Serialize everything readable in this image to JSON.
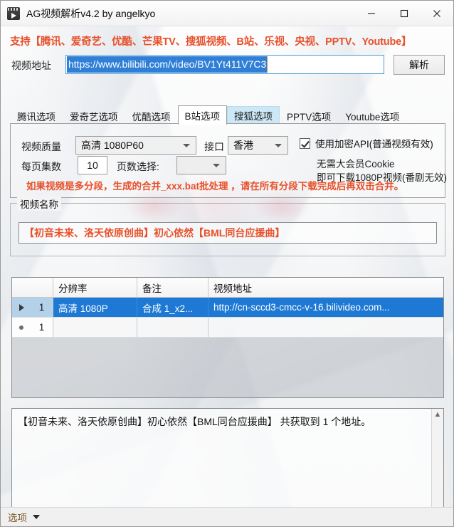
{
  "window": {
    "title": "AG视频解析v4.2 by angelkyo",
    "icon": "film-play-icon",
    "minimize_label": "minimize",
    "maximize_label": "maximize",
    "close_label": "close"
  },
  "header": {
    "support_text": "支持【腾讯、爱奇艺、优酷、芒果TV、搜狐视频、B站、乐视、央视、PPTV、Youtube】",
    "support_color": "#e8502a"
  },
  "url_row": {
    "label": "视频地址",
    "value": "https://www.bilibili.com/video/BV1Yt411V7C3",
    "placeholder": "",
    "selected": true,
    "parse_button": "解析"
  },
  "tabs": [
    {
      "label": "腾讯选项",
      "state": "normal"
    },
    {
      "label": "爱奇艺选项",
      "state": "normal"
    },
    {
      "label": "优酷选项",
      "state": "normal"
    },
    {
      "label": "B站选项",
      "state": "active"
    },
    {
      "label": "搜狐选项",
      "state": "hover"
    },
    {
      "label": "PPTV选项",
      "state": "normal"
    },
    {
      "label": "Youtube选项",
      "state": "normal"
    }
  ],
  "panel": {
    "quality_label": "视频质量",
    "quality_value": "高清 1080P60",
    "api_label": "接口",
    "api_value": "香港",
    "encrypt_checkbox_label": "使用加密API(普通视频有效)",
    "encrypt_checked": true,
    "note_line1": "无需大会员Cookie",
    "note_line2": "即可下载1080P视频(番剧无效)",
    "episodes_label": "每页集数",
    "episodes_value": "10",
    "page_select_label": "页数选择:",
    "page_select_value": "",
    "warning": "如果视频是多分段，生成的合并_xxx.bat批处理 ，请在所有分段下载完成后再双击合并。",
    "warning_color": "#e8502a"
  },
  "name_group": {
    "title": "视频名称",
    "value": "【初音未来、洛天依原创曲】初心依然【BML同台应援曲】",
    "value_color": "#e8502a"
  },
  "grid": {
    "columns": [
      "",
      "分辨率",
      "备注",
      "视频地址"
    ],
    "rows": [
      {
        "marker": "arrow",
        "number": "1",
        "resolution": "高清 1080P",
        "note": "合成 1_x2...",
        "url": "http://cn-sccd3-cmcc-v-16.bilivideo.com...",
        "selected": true
      },
      {
        "marker": "new",
        "number": "1",
        "resolution": "",
        "note": "",
        "url": "",
        "selected": false
      }
    ],
    "selection_color": "#1e79d4"
  },
  "log": {
    "text": "【初音未来、洛天依原创曲】初心依然【BML同台应援曲】 共获取到 1 个地址。",
    "scroll_up": "▲",
    "scroll_down": "▼"
  },
  "statusbar": {
    "menu_label": "选项"
  }
}
